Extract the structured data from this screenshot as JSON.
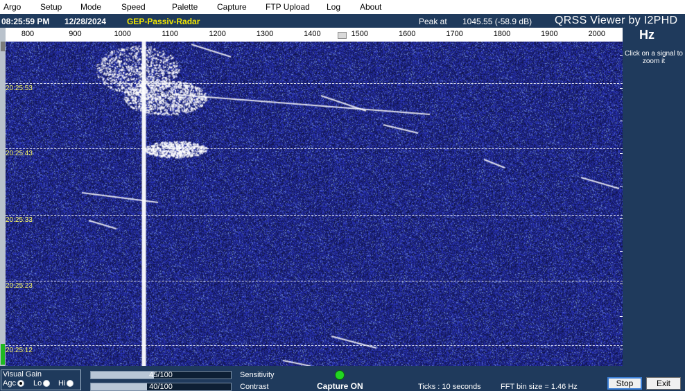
{
  "menu": {
    "items": [
      {
        "label": "Argo",
        "name": "menu-argo"
      },
      {
        "label": "Setup",
        "name": "menu-setup"
      },
      {
        "label": "Mode",
        "name": "menu-mode"
      },
      {
        "label": "Speed",
        "name": "menu-speed"
      },
      {
        "label": "Palette",
        "name": "menu-palette"
      },
      {
        "label": "Capture",
        "name": "menu-capture"
      },
      {
        "label": "FTP Upload",
        "name": "menu-ftp-upload"
      },
      {
        "label": "Log",
        "name": "menu-log"
      },
      {
        "label": "About",
        "name": "menu-about"
      }
    ]
  },
  "info": {
    "time": "08:25:59 PM",
    "date": "12/28/2024",
    "station": "GEP-Passiv-Radar",
    "peak_label": "Peak at",
    "peak_value": "1045.55 (-58.9 dB)",
    "app_title": "QRSS Viewer by I2PHD"
  },
  "ruler": {
    "unit": "Hz",
    "labels": [
      "800",
      "900",
      "1000",
      "1100",
      "1200",
      "1300",
      "1400",
      "1500",
      "1600",
      "1700",
      "1800",
      "1900",
      "2000"
    ]
  },
  "hint": "Click on a signal to zoom it",
  "waterfall": {
    "time_markers": [
      "20:25:53",
      "20:25:43",
      "20:25:33",
      "20:25:23",
      "20:25:12"
    ]
  },
  "controls": {
    "visual_gain": {
      "title": "Visual Gain",
      "options": [
        "Agc",
        "Lo",
        "Hi"
      ],
      "selected": "Agc"
    },
    "sensitivity": {
      "label": "Sensitivity",
      "value_text": "45/100",
      "value": 45
    },
    "contrast": {
      "label": "Contrast",
      "value_text": "40/100",
      "value": 40
    },
    "capture_status": "Capture ON",
    "ticks": "Ticks  : 10 seconds",
    "fft": "FFT bin size = 1.46 Hz",
    "stop_label": "Stop",
    "exit_label": "Exit"
  },
  "colors": {
    "background": "#1f3a5c",
    "waterfall_bg": "#0b1458",
    "station": "#f2e600",
    "time_marker": "#ffff66",
    "capture_led": "#22d622"
  }
}
